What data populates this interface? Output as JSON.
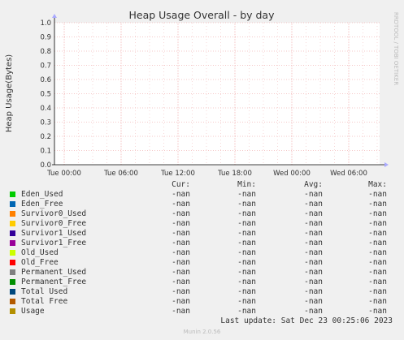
{
  "chart_data": {
    "type": "line",
    "title": "Heap Usage Overall - by day",
    "ylabel": "Heap Usage(Bytes)",
    "side_label": "RRDTOOL / TOBI OETIKER",
    "ylim": [
      0.0,
      1.0
    ],
    "y_ticks": [
      "0.0",
      "0.1",
      "0.2",
      "0.3",
      "0.4",
      "0.5",
      "0.6",
      "0.7",
      "0.8",
      "0.9",
      "1.0"
    ],
    "x_ticks": [
      "Tue 00:00",
      "Tue 06:00",
      "Tue 12:00",
      "Tue 18:00",
      "Wed 00:00",
      "Wed 06:00"
    ],
    "grid": true,
    "series": [
      {
        "name": "Eden_Used",
        "color": "#00cc00",
        "cur": "-nan",
        "min": "-nan",
        "avg": "-nan",
        "max": "-nan"
      },
      {
        "name": "Eden_Free",
        "color": "#0066b3",
        "cur": "-nan",
        "min": "-nan",
        "avg": "-nan",
        "max": "-nan"
      },
      {
        "name": "Survivor0_Used",
        "color": "#ff8000",
        "cur": "-nan",
        "min": "-nan",
        "avg": "-nan",
        "max": "-nan"
      },
      {
        "name": "Survivor0_Free",
        "color": "#ffcc00",
        "cur": "-nan",
        "min": "-nan",
        "avg": "-nan",
        "max": "-nan"
      },
      {
        "name": "Survivor1_Used",
        "color": "#330099",
        "cur": "-nan",
        "min": "-nan",
        "avg": "-nan",
        "max": "-nan"
      },
      {
        "name": "Survivor1_Free",
        "color": "#990099",
        "cur": "-nan",
        "min": "-nan",
        "avg": "-nan",
        "max": "-nan"
      },
      {
        "name": "Old_Used",
        "color": "#ccff00",
        "cur": "-nan",
        "min": "-nan",
        "avg": "-nan",
        "max": "-nan"
      },
      {
        "name": "Old_Free",
        "color": "#ff0000",
        "cur": "-nan",
        "min": "-nan",
        "avg": "-nan",
        "max": "-nan"
      },
      {
        "name": "Permanent_Used",
        "color": "#808080",
        "cur": "-nan",
        "min": "-nan",
        "avg": "-nan",
        "max": "-nan"
      },
      {
        "name": "Permanent_Free",
        "color": "#008f00",
        "cur": "-nan",
        "min": "-nan",
        "avg": "-nan",
        "max": "-nan"
      },
      {
        "name": "Total Used",
        "color": "#00487d",
        "cur": "-nan",
        "min": "-nan",
        "avg": "-nan",
        "max": "-nan"
      },
      {
        "name": "Total Free",
        "color": "#b35a00",
        "cur": "-nan",
        "min": "-nan",
        "avg": "-nan",
        "max": "-nan"
      },
      {
        "name": "Usage",
        "color": "#b38f00",
        "cur": "-nan",
        "min": "-nan",
        "avg": "-nan",
        "max": "-nan"
      }
    ]
  },
  "legend_headers": {
    "cur": "Cur:",
    "min": "Min:",
    "avg": "Avg:",
    "max": "Max:"
  },
  "last_update": "Last update: Sat Dec 23 00:25:06 2023",
  "footer": "Munin 2.0.56"
}
